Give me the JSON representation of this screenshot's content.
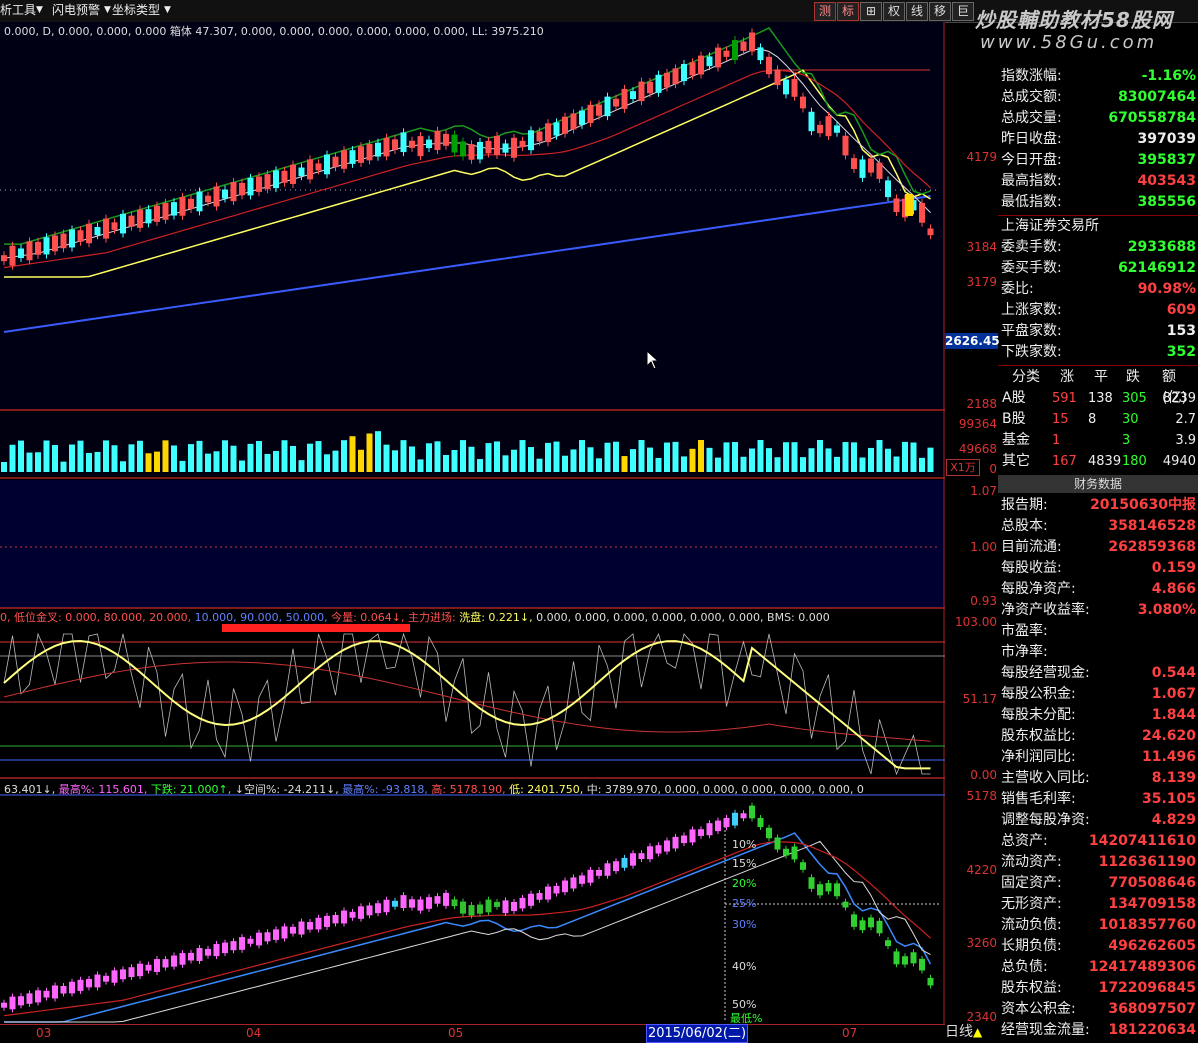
{
  "toolbar": {
    "tools": "析工具",
    "alert": "闪电预警",
    "coord": "坐标类型",
    "buttons": [
      "测",
      "标",
      "⊞",
      "权",
      "线",
      "移",
      "巨"
    ],
    "watermark_title": "炒股輔助教材58股网",
    "watermark_url": "www.58Gu.com"
  },
  "main_chart": {
    "indicator_line": "0.000, D, 0.000, 0.000, 0.000  箱体  47.307, 0.000, 0.000, 0.000, 0.000, 0.000, 0.000, LL: 3975.210",
    "y_labels": [
      "4179",
      "3184",
      "3179",
      "2188"
    ],
    "price_tag": "2626.45",
    "colors": {
      "ma_long": "#3a5cff",
      "box": "#ffff60",
      "up": "#ff5050",
      "down": "#40ffff",
      "volume_hi": "#ffd700"
    }
  },
  "volume_panel": {
    "y_labels": [
      "99364",
      "49668",
      "0"
    ],
    "unit_tag": "X1万"
  },
  "ratio_panel": {
    "y_labels": [
      "1.07",
      "1.00",
      "0.93"
    ]
  },
  "osc_panel": {
    "legend": [
      {
        "text": "0, 低位金叉: 0.000, 80.000, 20.000, ",
        "color": "#ff5050"
      },
      {
        "text": "10.000, 90.000, 50.000, ",
        "color": "#6080ff"
      },
      {
        "text": "今量: 0.064↓, ",
        "color": "#ff5050"
      },
      {
        "text": "主力进场: ",
        "color": "#ff5050"
      },
      {
        "text": "洗盘: 0.221↓, ",
        "color": "#ffff60"
      },
      {
        "text": "0.000, 0.000, 0.000, 0.000, 0.000, 0.000, BMS: 0.000",
        "color": "#ddd"
      }
    ],
    "y_labels": [
      "103.00",
      "51.17",
      "0.00"
    ]
  },
  "bottom_panel": {
    "legend": [
      {
        "text": "63.401↓, ",
        "color": "#ddd"
      },
      {
        "text": "最高%: 115.601, ",
        "color": "#ff66ff"
      },
      {
        "text": "下跌: 21.000↑, ",
        "color": "#30ff30"
      },
      {
        "text": "↓空间%: -24.211↓, ",
        "color": "#ddd"
      },
      {
        "text": "最高%: -93.818, ",
        "color": "#6080ff"
      },
      {
        "text": "高: 5178.190, ",
        "color": "#ff5050"
      },
      {
        "text": "低: 2401.750, ",
        "color": "#ffff60"
      },
      {
        "text": "中: 3789.970, 0.000, 0.000, 0.000, 0.000, 0.000, 0",
        "color": "#ddd"
      }
    ],
    "y_labels": [
      "5178",
      "4220",
      "3260",
      "2340"
    ],
    "pct_labels": [
      "10%",
      "15%",
      "20%",
      "25%",
      "30%",
      "40%",
      "50%"
    ],
    "low_label": "最低%"
  },
  "xaxis": {
    "months": [
      "03",
      "04",
      "05",
      "07"
    ],
    "date_box": "2015/06/02(二)",
    "period": "日线"
  },
  "sidebar": {
    "top_rows": [
      {
        "k": "指数涨幅:",
        "v": "-1.16%",
        "c": "green"
      },
      {
        "k": "总成交额:",
        "v": "83007464",
        "c": "green"
      },
      {
        "k": "总成交量:",
        "v": "670558784",
        "c": "green"
      },
      {
        "k": "昨日收盘:",
        "v": "397039",
        "c": "white"
      },
      {
        "k": "今日开盘:",
        "v": "395837",
        "c": "green"
      },
      {
        "k": "最高指数:",
        "v": "403543",
        "c": "red"
      },
      {
        "k": "最低指数:",
        "v": "385556",
        "c": "green"
      }
    ],
    "exchange": "上海证券交易所",
    "mid_rows": [
      {
        "k": "委卖手数:",
        "v": "2933688",
        "c": "green"
      },
      {
        "k": "委买手数:",
        "v": "62146912",
        "c": "green"
      },
      {
        "k": "委比:",
        "v": "90.98%",
        "c": "red"
      },
      {
        "k": "上涨家数:",
        "v": "609",
        "c": "red"
      },
      {
        "k": "平盘家数:",
        "v": "153",
        "c": "white"
      },
      {
        "k": "下跌家数:",
        "v": "352",
        "c": "green"
      }
    ],
    "table_header": [
      "分类",
      "涨",
      "平",
      "跌",
      "额(亿)"
    ],
    "table_rows": [
      {
        "name": "A股",
        "up": "591",
        "flat": "138",
        "down": "305",
        "amt": "8239"
      },
      {
        "name": "B股",
        "up": "15",
        "flat": "8",
        "down": "30",
        "amt": "2.7"
      },
      {
        "name": "基金",
        "up": "1",
        "flat": "",
        "down": "3",
        "amt": "3.9"
      },
      {
        "name": "其它",
        "up": "167",
        "flat": "4839",
        "down": "180",
        "amt": "4940"
      }
    ],
    "fin_title": "财务数据",
    "fin_rows": [
      {
        "k": "报告期:",
        "v": "20150630中报",
        "c": "red"
      },
      {
        "k": "总股本:",
        "v": "358146528",
        "c": "red"
      },
      {
        "k": "目前流通:",
        "v": "262859368",
        "c": "red"
      },
      {
        "k": "每股收益:",
        "v": "0.159",
        "c": "red"
      },
      {
        "k": "每股净资产:",
        "v": "4.866",
        "c": "red"
      },
      {
        "k": "净资产收益率:",
        "v": "3.080%",
        "c": "red"
      },
      {
        "k": "市盈率:",
        "v": "",
        "c": "red"
      },
      {
        "k": "市净率:",
        "v": "",
        "c": "red"
      },
      {
        "k": "每股经营现金:",
        "v": "0.544",
        "c": "red"
      },
      {
        "k": "每股公积金:",
        "v": "1.067",
        "c": "red"
      },
      {
        "k": "每股未分配:",
        "v": "1.844",
        "c": "red"
      },
      {
        "k": "股东权益比:",
        "v": "24.620",
        "c": "red"
      },
      {
        "k": "净利润同比:",
        "v": "11.496",
        "c": "red"
      },
      {
        "k": "主营收入同比:",
        "v": "8.139",
        "c": "red"
      },
      {
        "k": "销售毛利率:",
        "v": "35.105",
        "c": "red"
      },
      {
        "k": "调整每股净资:",
        "v": "4.829",
        "c": "red"
      },
      {
        "k": "总资产:",
        "v": "14207411610",
        "c": "red"
      },
      {
        "k": "流动资产:",
        "v": "1126361190",
        "c": "red"
      },
      {
        "k": "固定资产:",
        "v": "770508646",
        "c": "red"
      },
      {
        "k": "无形资产:",
        "v": "134709158",
        "c": "red"
      },
      {
        "k": "流动负债:",
        "v": "1018357760",
        "c": "red"
      },
      {
        "k": "长期负债:",
        "v": "496262605",
        "c": "red"
      },
      {
        "k": "总负债:",
        "v": "12417489306",
        "c": "red"
      },
      {
        "k": "股东权益:",
        "v": "1722096845",
        "c": "red"
      },
      {
        "k": "资本公积金:",
        "v": "368097507",
        "c": "red"
      },
      {
        "k": "经营现金流量:",
        "v": "181220634",
        "c": "red"
      }
    ]
  }
}
